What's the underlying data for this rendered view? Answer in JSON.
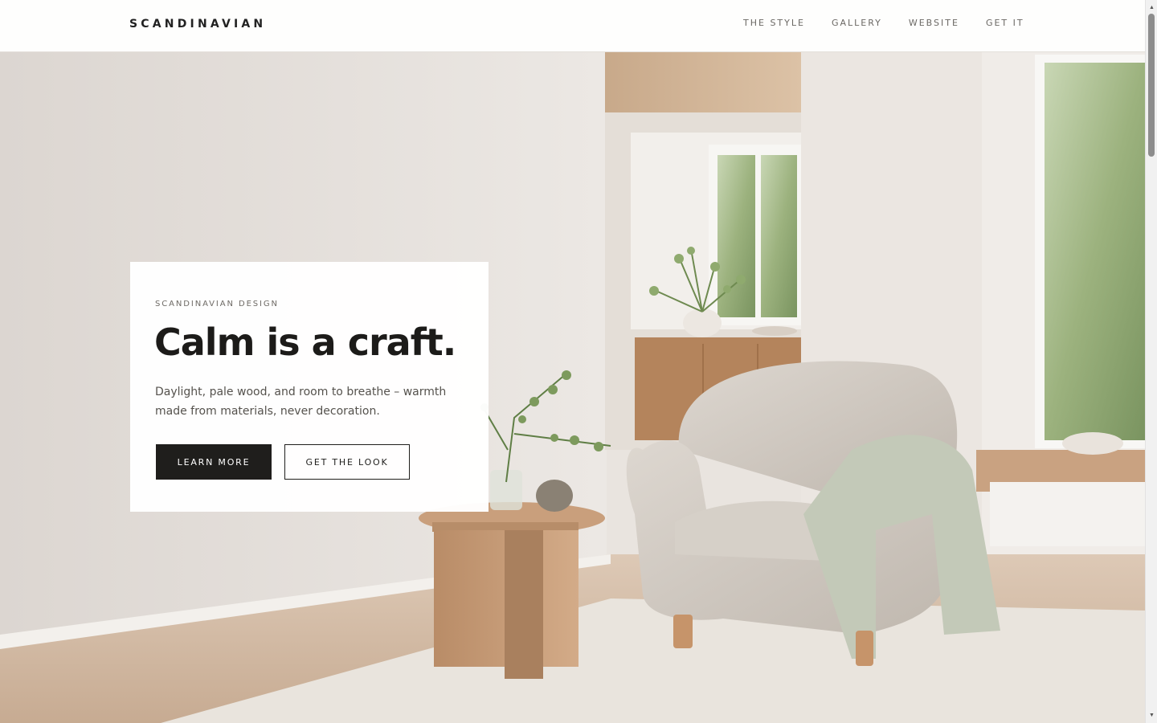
{
  "header": {
    "brand": "SCANDINAVIAN",
    "nav": [
      "THE STYLE",
      "GALLERY",
      "WEBSITE",
      "GET IT"
    ]
  },
  "hero": {
    "image_description_icon": "interior-photo",
    "card": {
      "eyebrow": "SCANDINAVIAN DESIGN",
      "headline": "Calm is a craft.",
      "body": "Daylight, pale wood, and room to breathe – warmth made from materials, never decoration.",
      "primary_button": "LEARN MORE",
      "secondary_button": "GET THE LOOK"
    }
  },
  "scrollbar": {
    "up_icon": "▲",
    "down_icon": "▼"
  },
  "colors": {
    "wall": "#e6e1dc",
    "wood": "#c99f7c",
    "button_dark": "#1f1e1c",
    "foliage": "#7f9a63"
  }
}
